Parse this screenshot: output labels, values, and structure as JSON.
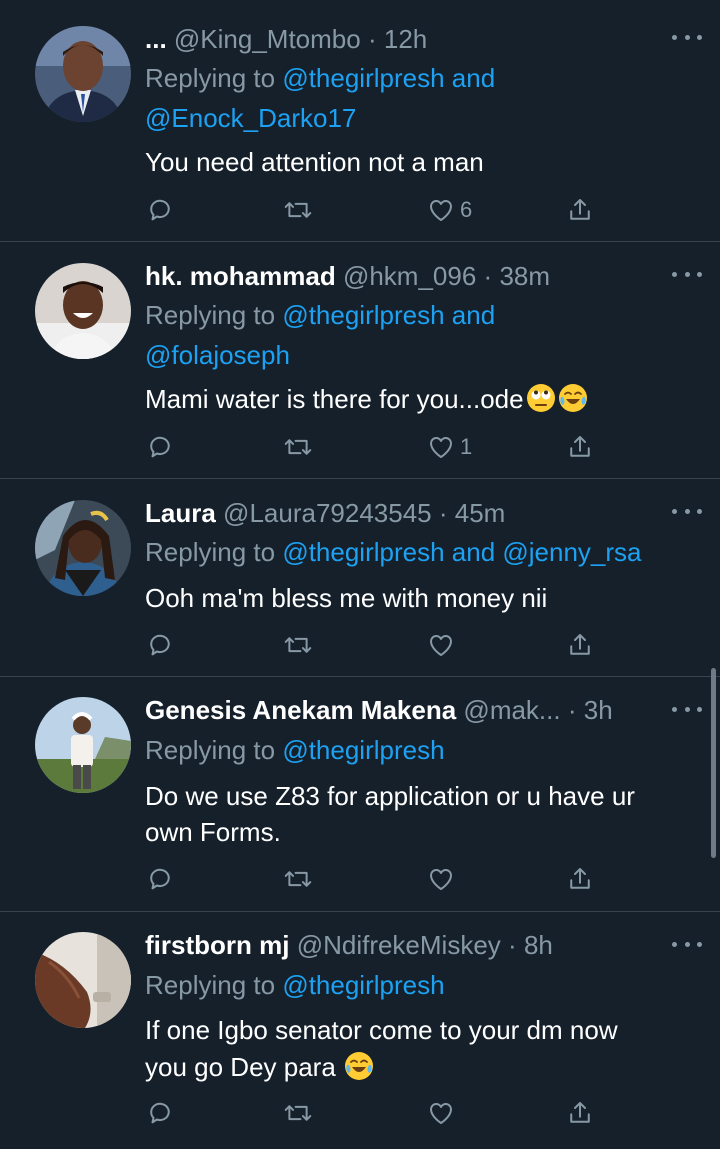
{
  "tweets": [
    {
      "name": "...",
      "handle": "@King_Mtombo",
      "dot": "·",
      "time": "12h",
      "replying_prefix": "Replying to",
      "replying_line1": "@thegirlpresh and",
      "replying_line2": "@Enock_Darko17",
      "text": "You need attention not a man",
      "emojis": [],
      "likes": "6",
      "avatar": "avatar-man-suit"
    },
    {
      "name": "hk. mohammad",
      "handle": "@hkm_096",
      "dot": "·",
      "time": "38m",
      "replying_prefix": "Replying to",
      "replying_line1": "@thegirlpresh and",
      "replying_line2": "@folajoseph",
      "text": "Mami water is there for you...ode",
      "emojis": [
        "face-with-rolling-eyes",
        "face-with-tears-of-joy"
      ],
      "likes": "1",
      "avatar": "avatar-smiling-man"
    },
    {
      "name": "Laura",
      "handle": "@Laura79243545",
      "dot": "·",
      "time": "45m",
      "replying_prefix": "Replying to",
      "replying_line1": "@thegirlpresh and @jenny_rsa",
      "replying_line2": "",
      "text": "Ooh ma'm bless me with money nii",
      "emojis": [],
      "likes": "",
      "avatar": "avatar-woman-braids"
    },
    {
      "name": "Genesis Anekam Makena",
      "handle": "@mak...",
      "dot": "·",
      "time": "3h",
      "replying_prefix": "Replying to",
      "replying_line1": "@thegirlpresh",
      "replying_line2": "",
      "text_line1": "Do we use Z83 for application or u have ur",
      "text_line2": "own Forms.",
      "emojis": [],
      "likes": "",
      "avatar": "avatar-person-outdoors"
    },
    {
      "name": "firstborn mj",
      "handle": "@NdifrekeMiskey",
      "dot": "·",
      "time": "8h",
      "replying_prefix": "Replying to",
      "replying_line1": "@thegirlpresh",
      "replying_line2": "",
      "text_line1": "If one Igbo senator come to your dm now",
      "text_line2": "you go Dey para",
      "emojis": [
        "face-with-tears-of-joy"
      ],
      "likes": "",
      "avatar": "avatar-hand-closeup"
    }
  ],
  "colors": {
    "background": "#15202b",
    "text": "#ffffff",
    "secondary": "#8899a6",
    "link": "#1da1f2",
    "divider": "#38444d"
  },
  "icons": [
    "reply-icon",
    "retweet-icon",
    "like-icon",
    "share-icon",
    "more-icon"
  ]
}
